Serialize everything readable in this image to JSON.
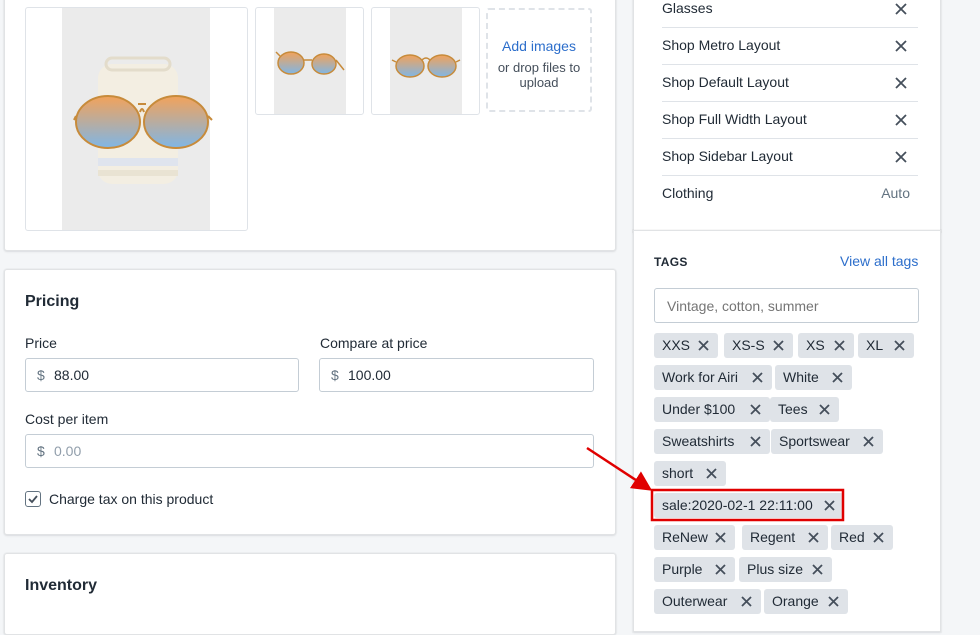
{
  "media": {
    "upload_add": "Add images",
    "upload_drop": "or drop files to upload"
  },
  "pricing": {
    "title": "Pricing",
    "price_label": "Price",
    "price_prefix": "$",
    "price_value": "88.00",
    "compare_label": "Compare at price",
    "compare_prefix": "$",
    "compare_value": "100.00",
    "cost_label": "Cost per item",
    "cost_prefix": "$",
    "cost_placeholder": "0.00",
    "charge_tax_label": "Charge tax on this product",
    "charge_tax_checked": true
  },
  "inventory": {
    "title": "Inventory"
  },
  "collections": {
    "items": [
      {
        "name": "Glasses"
      },
      {
        "name": "Shop Metro Layout"
      },
      {
        "name": "Shop Default Layout"
      },
      {
        "name": "Shop Full Width Layout"
      },
      {
        "name": "Shop Sidebar Layout"
      },
      {
        "name": "Clothing",
        "auto": "Auto"
      }
    ]
  },
  "tags": {
    "title": "TAGS",
    "view_all": "View all tags",
    "placeholder": "Vintage, cotton, summer",
    "list": [
      "XXS",
      "XS-S",
      "XS",
      "XL",
      "Work for Airi",
      "White",
      "Under $100",
      "Tees",
      "Sweatshirts",
      "Sportswear",
      "short",
      "sale:2020-02-1 22:11:00",
      "ReNew",
      "Regent",
      "Red",
      "Purple",
      "Plus size",
      "Outerwear",
      "Orange"
    ],
    "highlight_color": "#e00000",
    "accent_color": "#2c6ecb"
  }
}
